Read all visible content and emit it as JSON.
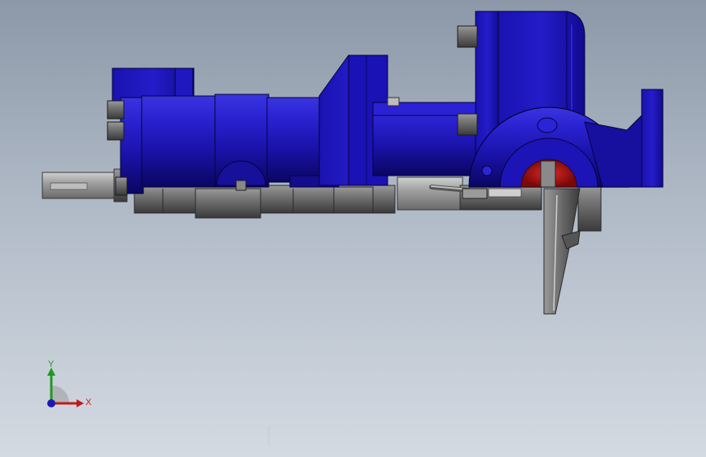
{
  "viewport": {
    "background_top": "#8c98a8",
    "background_bottom": "#d4dae2"
  },
  "model": {
    "primary_color": "#1b12b8",
    "dark_color": "#0c0870",
    "steel_color": "#6e6e6e",
    "accent_color": "#b01818"
  },
  "triad": {
    "x_label": "X",
    "y_label": "Y",
    "x_color": "#c01c1c",
    "y_color": "#1e9a1e",
    "z_color": "#1a1ab0"
  }
}
